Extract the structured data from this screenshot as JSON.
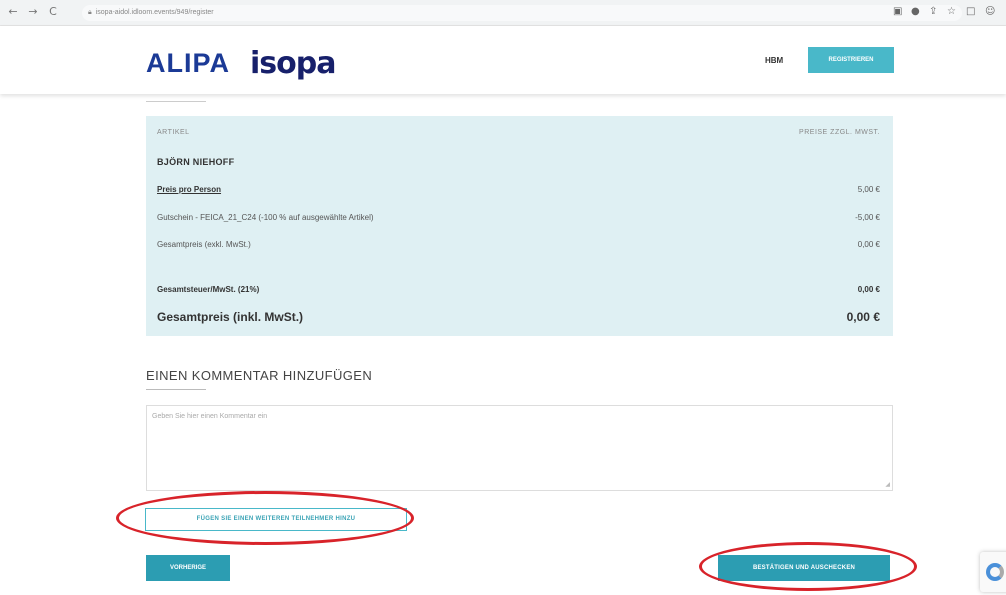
{
  "browser": {
    "url": "isopa-aidol.idloom.events/949/register",
    "nav": {
      "back": "←",
      "forward": "→",
      "reload": "C"
    }
  },
  "header": {
    "logo_alipa": "ALIPA",
    "logo_isopa": "isopa",
    "nav_link": "HBM",
    "register_label": "REGISTRIEREN"
  },
  "summary": {
    "col_article": "ARTIKEL",
    "col_price": "PREISE ZZGL. MWST.",
    "person": "BJÖRN NIEHOFF",
    "lines": [
      {
        "label": "Preis pro Person",
        "value": "5,00 €"
      },
      {
        "label": "Gutschein - FEICA_21_C24 (-100 % auf ausgewählte Artikel)",
        "value": "-5,00 €"
      },
      {
        "label": "Gesamtpreis (exkl. MwSt.)",
        "value": "0,00 €"
      }
    ],
    "tax_label": "Gesamtsteuer/MwSt. (21%)",
    "tax_value": "0,00 €",
    "total_label": "Gesamtpreis (inkl. MwSt.)",
    "total_value": "0,00 €"
  },
  "comment": {
    "title": "EINEN KOMMENTAR HINZUFÜGEN",
    "placeholder": "Geben Sie hier einen Kommentar ein"
  },
  "buttons": {
    "add_participant": "FÜGEN SIE EINEN WEITEREN TEILNEHMER HINZU",
    "previous": "VORHERIGE",
    "confirm": "BESTÄTIGEN UND AUSCHECKEN"
  },
  "colors": {
    "accent": "#2c9db2",
    "summary_bg": "#dff0f3",
    "annotation": "#d8232a",
    "brand_blue": "#1b3a96"
  },
  "icons": [
    "back-arrow-icon",
    "forward-arrow-icon",
    "reload-icon",
    "lock-icon",
    "extension-icon",
    "location-icon",
    "share-icon",
    "star-icon",
    "tab-icon",
    "profile-icon",
    "recaptcha-icon"
  ]
}
